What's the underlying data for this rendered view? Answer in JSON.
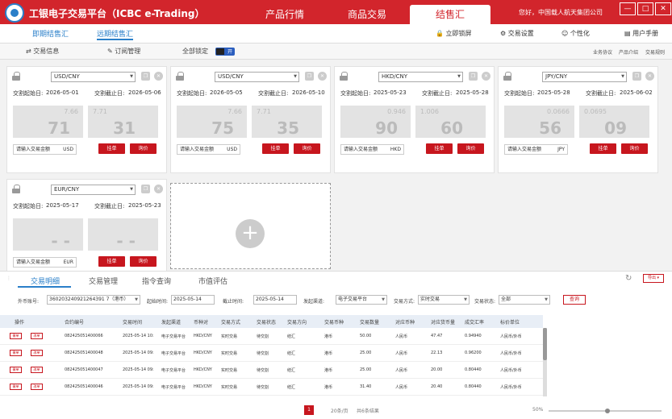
{
  "app": {
    "title": "工银电子交易平台（ICBC e-Trading）",
    "greeting": "您好，中国载人航天集团公司"
  },
  "main_tabs": [
    "产品行情",
    "商品交易",
    "结售汇"
  ],
  "window_buttons": [
    "—",
    "□",
    "✕"
  ],
  "toolbar": {
    "sub_tabs": [
      "即期结售汇",
      "远期结售汇"
    ],
    "actions": [
      "立即锁屏",
      "交易设置",
      "个性化",
      "用户手册"
    ]
  },
  "nav": {
    "items": [
      "交易信息",
      "订阅管理"
    ],
    "lock_label": "全部锁定",
    "toggle_label": "开",
    "right_links": [
      "业务协议",
      "产品介绍",
      "交易规则"
    ]
  },
  "cards": [
    {
      "pair": "USD/CNY",
      "start_label": "交割起始日:",
      "start": "2026-05-01",
      "end_label": "交割截止日:",
      "end": "2026-05-06",
      "buy_small": "7.66",
      "buy_big": "71",
      "sell_small": "7.71",
      "sell_big": "31",
      "amount_placeholder": "请输入交易金额",
      "currency": "USD",
      "btn_order": "挂单",
      "btn_quote": "询价"
    },
    {
      "pair": "USD/CNY",
      "start_label": "交割起始日:",
      "start": "2026-05-05",
      "end_label": "交割截止日:",
      "end": "2026-05-10",
      "buy_small": "7.66",
      "buy_big": "75",
      "sell_small": "7.71",
      "sell_big": "35",
      "amount_placeholder": "请输入交易金额",
      "currency": "USD",
      "btn_order": "挂单",
      "btn_quote": "询价"
    },
    {
      "pair": "HKD/CNY",
      "start_label": "交割起始日:",
      "start": "2025-05-23",
      "end_label": "交割截止日:",
      "end": "2025-05-28",
      "buy_small": "0.946",
      "buy_big": "90",
      "sell_small": "1.006",
      "sell_big": "60",
      "amount_placeholder": "请输入交易金额",
      "currency": "HKD",
      "btn_order": "挂单",
      "btn_quote": "询价"
    },
    {
      "pair": "JPY/CNY",
      "start_label": "交割起始日:",
      "start": "2025-05-28",
      "end_label": "交割截止日:",
      "end": "2025-06-02",
      "buy_small": "0.0666",
      "buy_big": "56",
      "sell_small": "0.0695",
      "sell_big": "09",
      "amount_placeholder": "请输入交易金额",
      "currency": "JPY",
      "btn_order": "挂单",
      "btn_quote": "询价"
    },
    {
      "pair": "EUR/CNY",
      "start_label": "交割起始日:",
      "start": "2025-05-17",
      "end_label": "交割截止日:",
      "end": "2025-05-23",
      "buy_small": "",
      "buy_big": "- -",
      "sell_small": "",
      "sell_big": "- -",
      "amount_placeholder": "请输入交易金额",
      "currency": "EUR",
      "btn_order": "挂单",
      "btn_quote": "询价"
    }
  ],
  "add_card": {
    "symbol": "+"
  },
  "bottom_tabs": [
    "交易明细",
    "交易管理",
    "指令查询",
    "市值评估"
  ],
  "more_label": "导出 ▾",
  "filters": {
    "account_label": "外币账号:",
    "account": "360203240921264391 7（港币）",
    "from_label": "起始时间:",
    "from": "2025-05-14",
    "to_label": "截止时间:",
    "to": "2025-05-14",
    "channel_label": "发起渠道:",
    "channel": "电子交易平台",
    "method_label": "交易方式:",
    "method": "实时交易",
    "status_label": "交易状态:",
    "status": "全部",
    "query": "查询"
  },
  "table": {
    "columns": [
      "操作",
      "合约编号",
      "交易时间",
      "发起渠道",
      "币种对",
      "交易方式",
      "交易状态",
      "交易方向",
      "交易币种",
      "交易数量",
      "对应币种",
      "对应货币量",
      "成交汇率",
      "标价单位"
    ],
    "op_buttons": [
      "撤单",
      "改单"
    ],
    "rows": [
      [
        "082425051400066",
        "2025-05-14 10:",
        "电子交易平台",
        "HKD/CNY",
        "实时交易",
        "待交割",
        "结汇",
        "港币",
        "50.00",
        "人民币",
        "47.47",
        "0.94940",
        "人民币/外币"
      ],
      [
        "082425051400048",
        "2025-05-14 09:",
        "电子交易平台",
        "HKD/CNY",
        "实时交易",
        "待交割",
        "结汇",
        "港币",
        "25.00",
        "人民币",
        "22.13",
        "0.96200",
        "人民币/外币"
      ],
      [
        "082425051400047",
        "2025-05-14 09:",
        "电子交易平台",
        "HKD/CNY",
        "实时交易",
        "待交割",
        "结汇",
        "港币",
        "25.00",
        "人民币",
        "20.00",
        "0.80440",
        "人民币/外币"
      ],
      [
        "082425051400046",
        "2025-05-14 09:",
        "电子交易平台",
        "HKD/CNY",
        "实时交易",
        "待交割",
        "结汇",
        "港币",
        "31.40",
        "人民币",
        "20.40",
        "0.80440",
        "人民币/外币"
      ]
    ]
  },
  "pagination": {
    "current": "1",
    "per_page": "20条/页",
    "total": "共6条结果",
    "zoom": "50%"
  }
}
